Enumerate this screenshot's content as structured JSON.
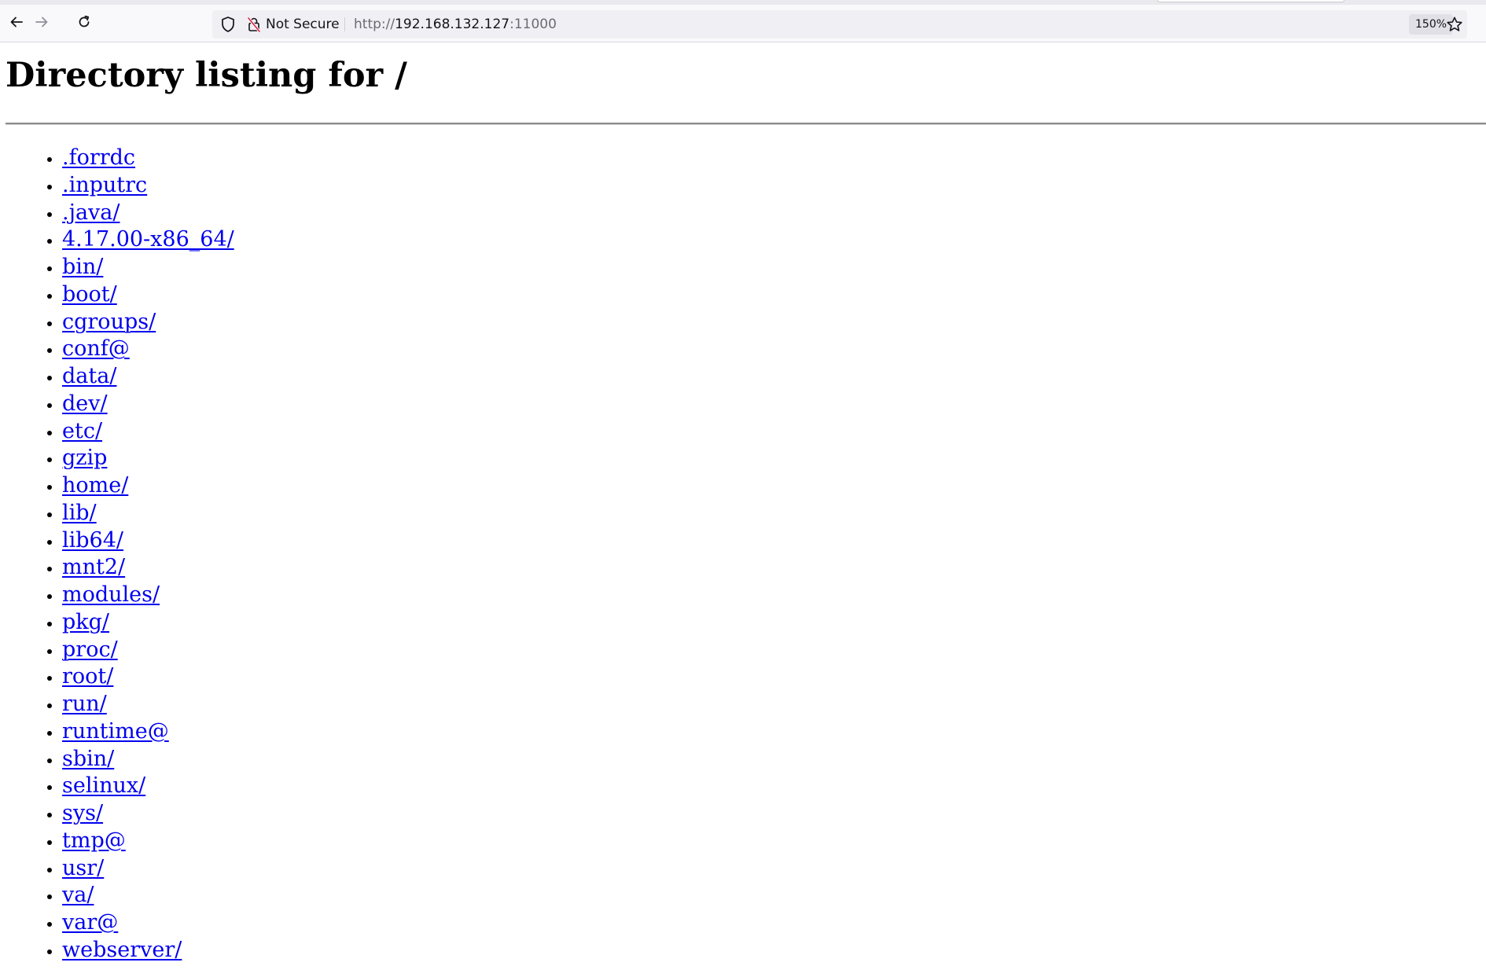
{
  "browser": {
    "security_label": "Not Secure",
    "url_scheme": "http://",
    "url_host": "192.168.132.127",
    "url_port": ":11000",
    "zoom_level": "150%",
    "icons": [
      "back-icon",
      "forward-icon",
      "reload-icon",
      "shield-icon",
      "insecure-lock-icon",
      "bookmark-star-icon"
    ]
  },
  "page": {
    "title": "Directory listing for /",
    "entries": [
      ".forrdc",
      ".inputrc",
      ".java/",
      "4.17.00-x86_64/",
      "bin/",
      "boot/",
      "cgroups/",
      "conf@",
      "data/",
      "dev/",
      "etc/",
      "gzip",
      "home/",
      "lib/",
      "lib64/",
      "mnt2/",
      "modules/",
      "pkg/",
      "proc/",
      "root/",
      "run/",
      "runtime@",
      "sbin/",
      "selinux/",
      "sys/",
      "tmp@",
      "usr/",
      "va/",
      "var@",
      "webserver/"
    ],
    "link_color": "#0000ee"
  }
}
